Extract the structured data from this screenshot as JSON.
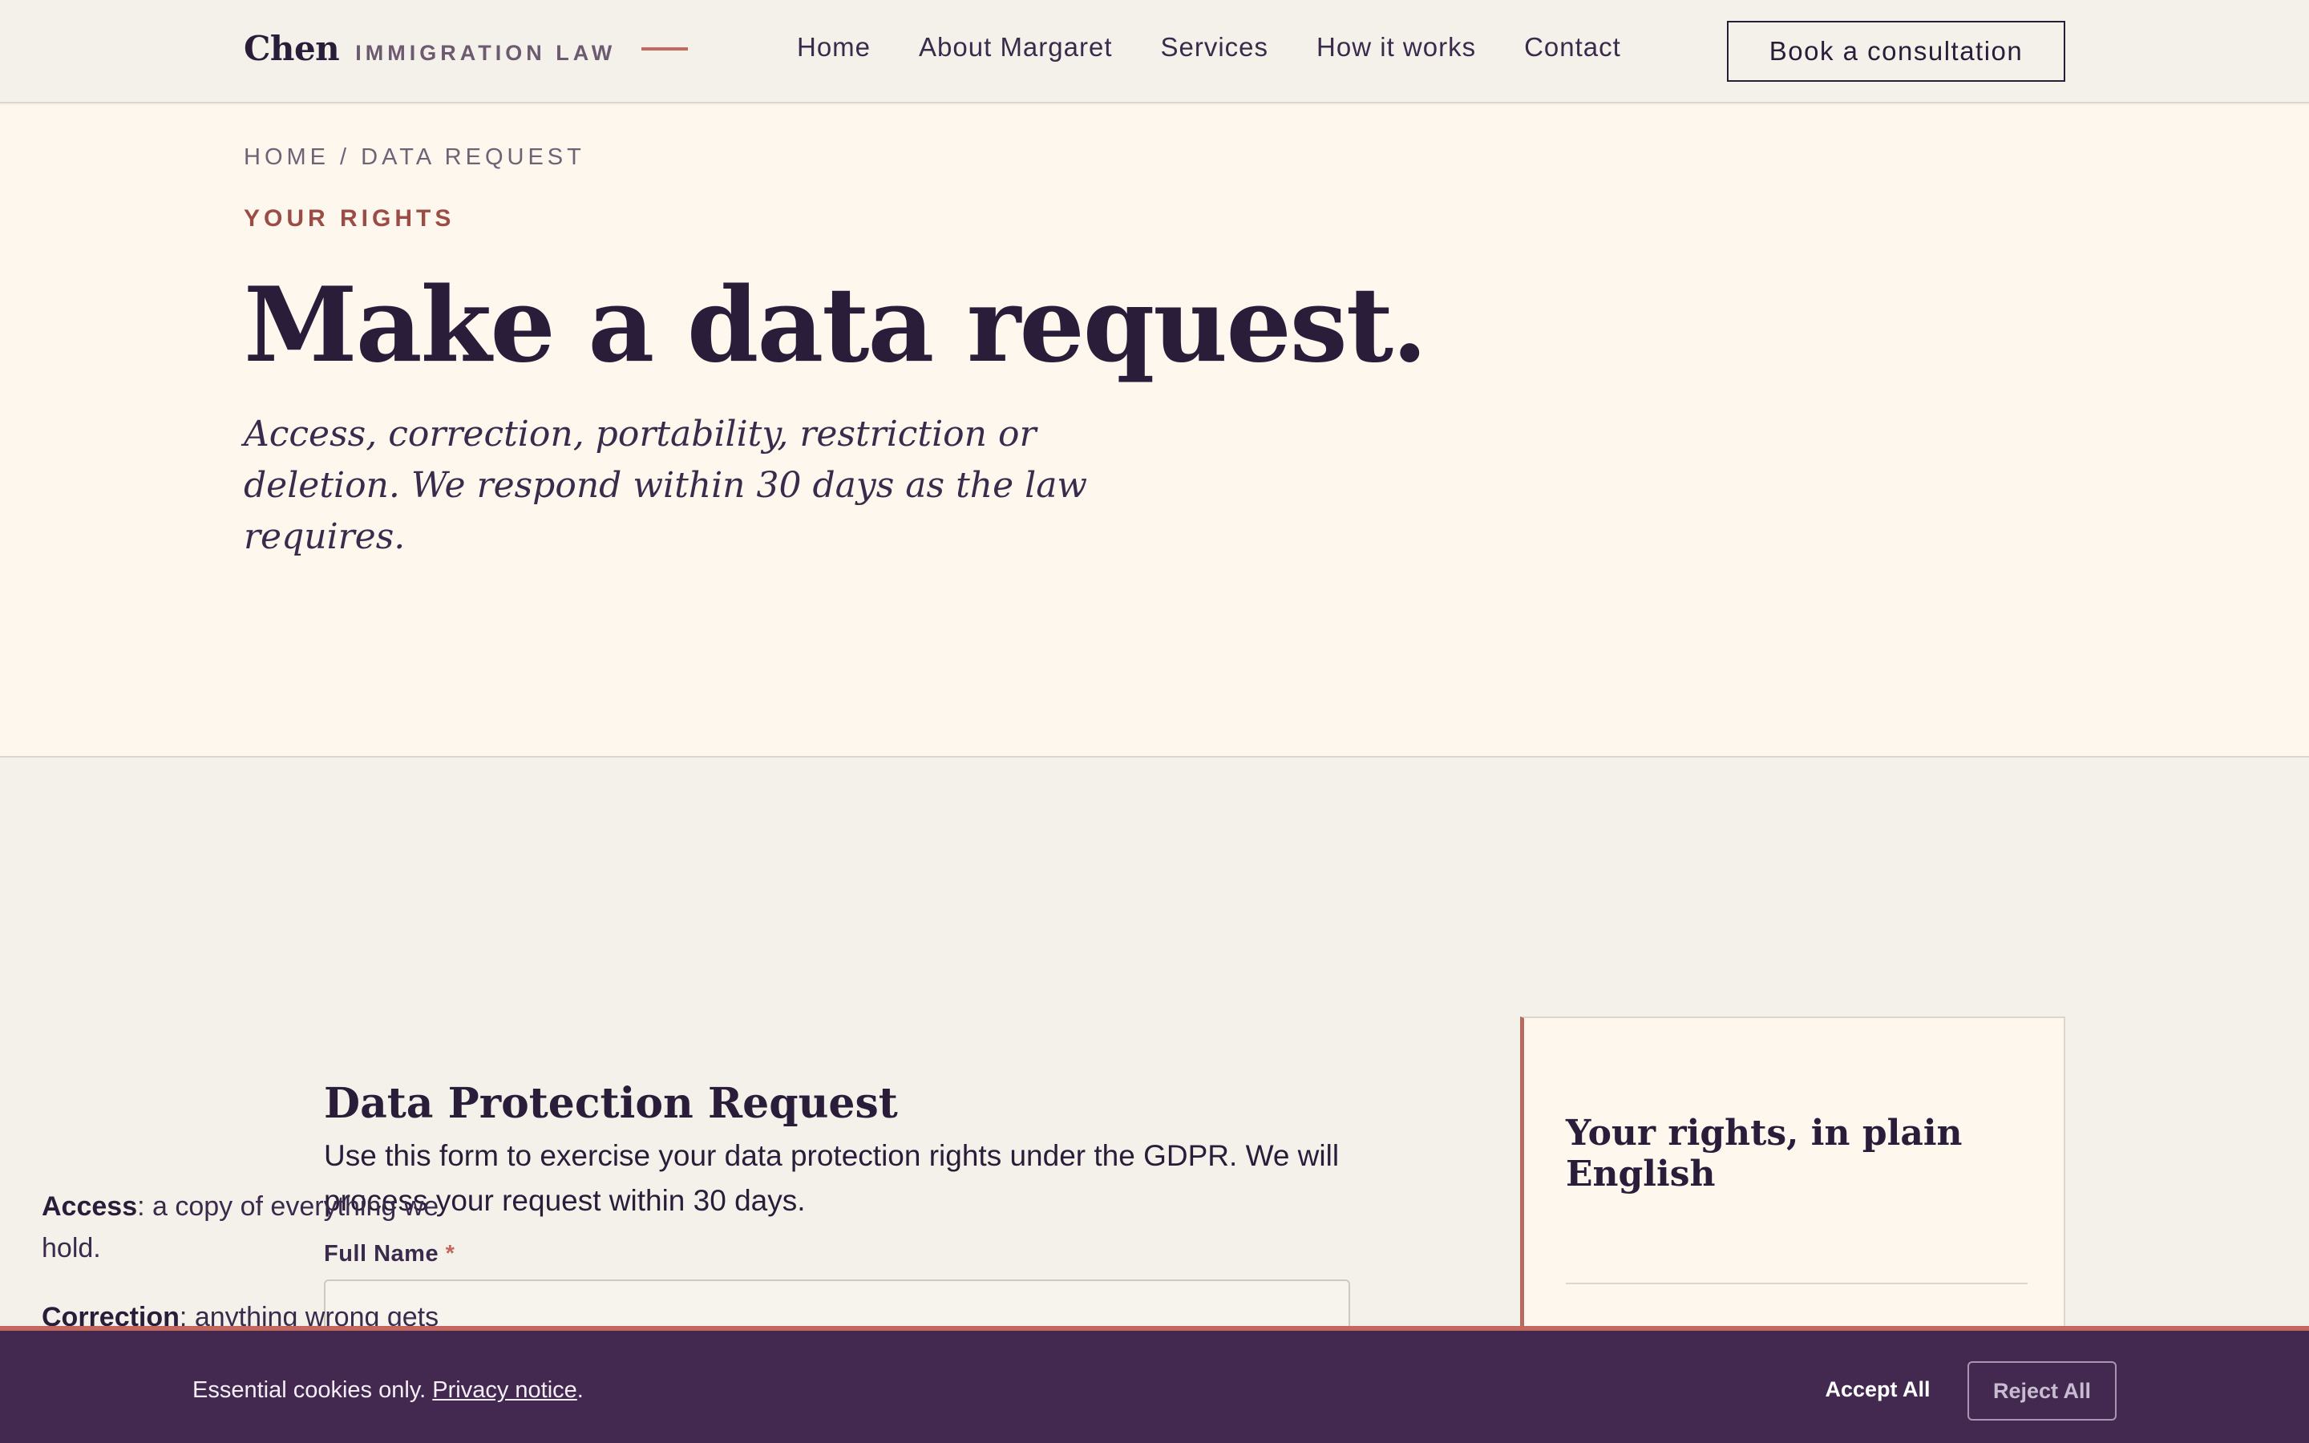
{
  "header": {
    "logo_name": "Chen",
    "logo_sub": "IMMIGRATION LAW",
    "nav": [
      "Home",
      "About Margaret",
      "Services",
      "How it works",
      "Contact"
    ],
    "cta": "Book a consultation"
  },
  "hero": {
    "breadcrumb": "HOME / DATA REQUEST",
    "eyebrow": "YOUR RIGHTS",
    "title": "Make a data request.",
    "lede": "Access, correction, portability, restriction or deletion. We respond within 30 days as the law requires."
  },
  "form": {
    "title": "Data Protection Request",
    "description": "Use this form to exercise your data protection rights under the GDPR. We will process your request within 30 days.",
    "full_name_label": "Full Name",
    "required_mark": "*",
    "full_name_value": ""
  },
  "aside": {
    "title": "Your rights, in plain English",
    "items": [
      {
        "term": "Access",
        "text": ": a copy of everything we hold."
      },
      {
        "term": "Correction",
        "text": ": anything wrong gets"
      }
    ]
  },
  "cookie": {
    "text": "Essential cookies only.",
    "link": "Privacy notice",
    "period": ".",
    "accept": "Accept All",
    "reject": "Reject All"
  },
  "colors": {
    "accent": "#c4675e",
    "dark": "#2a1d3a",
    "banner": "#432850",
    "hero_bg": "#fdf7ee",
    "page_bg": "#f4f1ea"
  }
}
